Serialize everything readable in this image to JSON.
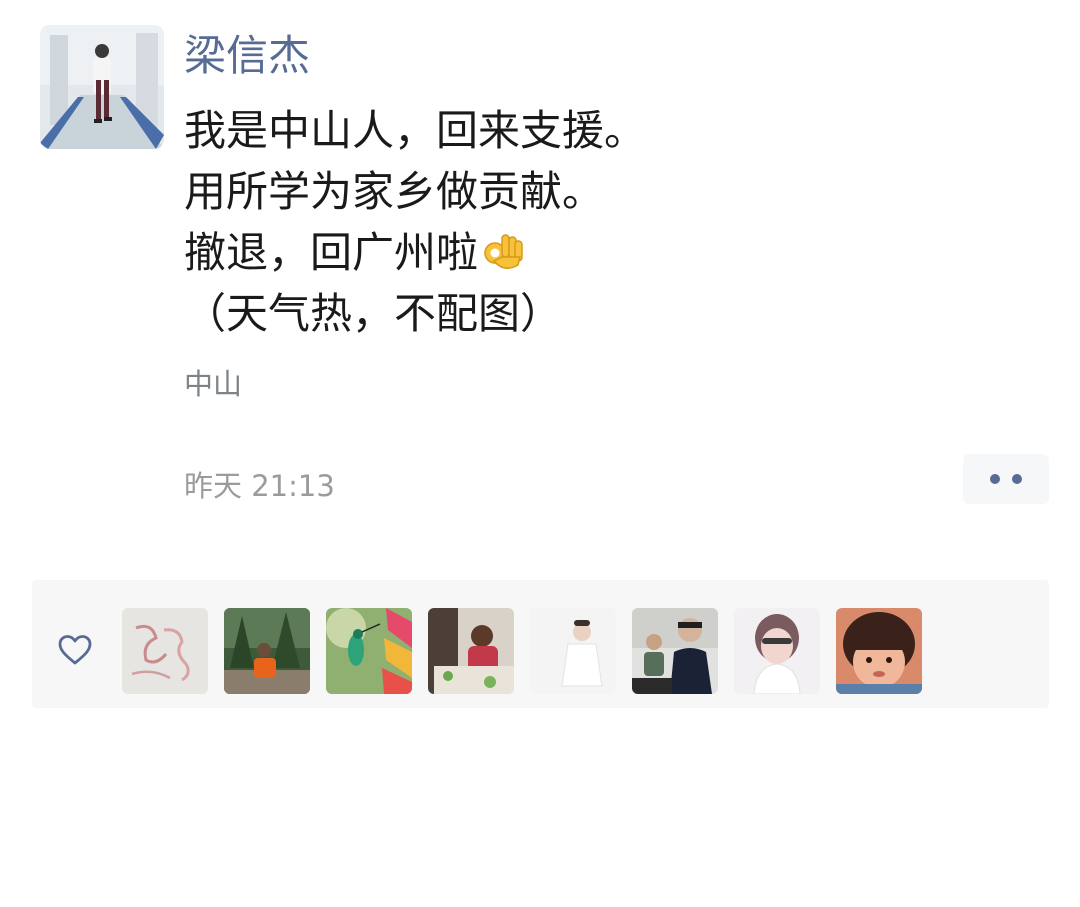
{
  "post": {
    "author": "梁信杰",
    "lines": [
      "我是中山人，回来支援。",
      "用所学为家乡做贡献。",
      "撤退，回广州啦",
      "（天气热，不配图）"
    ],
    "emoji": "ok-hand",
    "location": "中山",
    "time": "昨天 21:13"
  },
  "likes": {
    "icon": "heart-icon",
    "avatars": [
      "liker-1",
      "liker-2",
      "liker-3",
      "liker-4",
      "liker-5",
      "liker-6",
      "liker-7",
      "liker-8"
    ]
  },
  "colors": {
    "name": "#576b95",
    "text": "#1a1a1a",
    "meta": "#9b9b9b",
    "panel": "#f7f7f7"
  }
}
